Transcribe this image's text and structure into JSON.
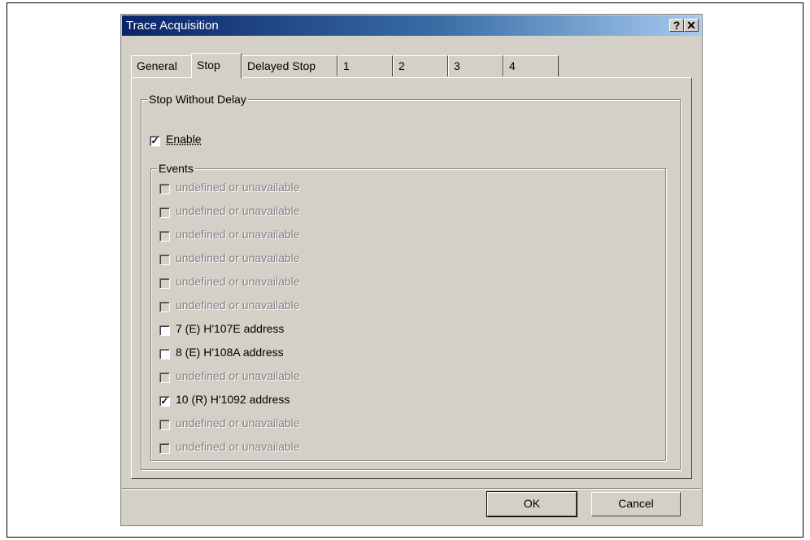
{
  "window": {
    "title": "Trace Acquisition",
    "help_glyph": "?",
    "close_glyph": "✕"
  },
  "tabs": [
    {
      "label": "General"
    },
    {
      "label": "Stop"
    },
    {
      "label": "Delayed Stop"
    },
    {
      "label": "1"
    },
    {
      "label": "2"
    },
    {
      "label": "3"
    },
    {
      "label": "4"
    }
  ],
  "active_tab": "Stop",
  "stop_group": {
    "label": "Stop Without Delay",
    "enable": {
      "label": "Enable",
      "checked": true
    }
  },
  "events_group": {
    "label": "Events",
    "items": [
      {
        "label": "undefined or unavailable",
        "checked": false,
        "enabled": false
      },
      {
        "label": "undefined or unavailable",
        "checked": false,
        "enabled": false
      },
      {
        "label": "undefined or unavailable",
        "checked": false,
        "enabled": false
      },
      {
        "label": "undefined or unavailable",
        "checked": false,
        "enabled": false
      },
      {
        "label": "undefined or unavailable",
        "checked": false,
        "enabled": false
      },
      {
        "label": "undefined or unavailable",
        "checked": false,
        "enabled": false
      },
      {
        "label": "7 (E) H'107E address",
        "checked": false,
        "enabled": true
      },
      {
        "label": "8 (E) H'108A address",
        "checked": false,
        "enabled": true
      },
      {
        "label": "undefined or unavailable",
        "checked": false,
        "enabled": false
      },
      {
        "label": "10 (R) H'1092 address",
        "checked": true,
        "enabled": true
      },
      {
        "label": "undefined or unavailable",
        "checked": false,
        "enabled": false
      },
      {
        "label": "undefined or unavailable",
        "checked": false,
        "enabled": false
      }
    ]
  },
  "buttons": {
    "ok": "OK",
    "cancel": "Cancel"
  },
  "check_glyph": "✓"
}
